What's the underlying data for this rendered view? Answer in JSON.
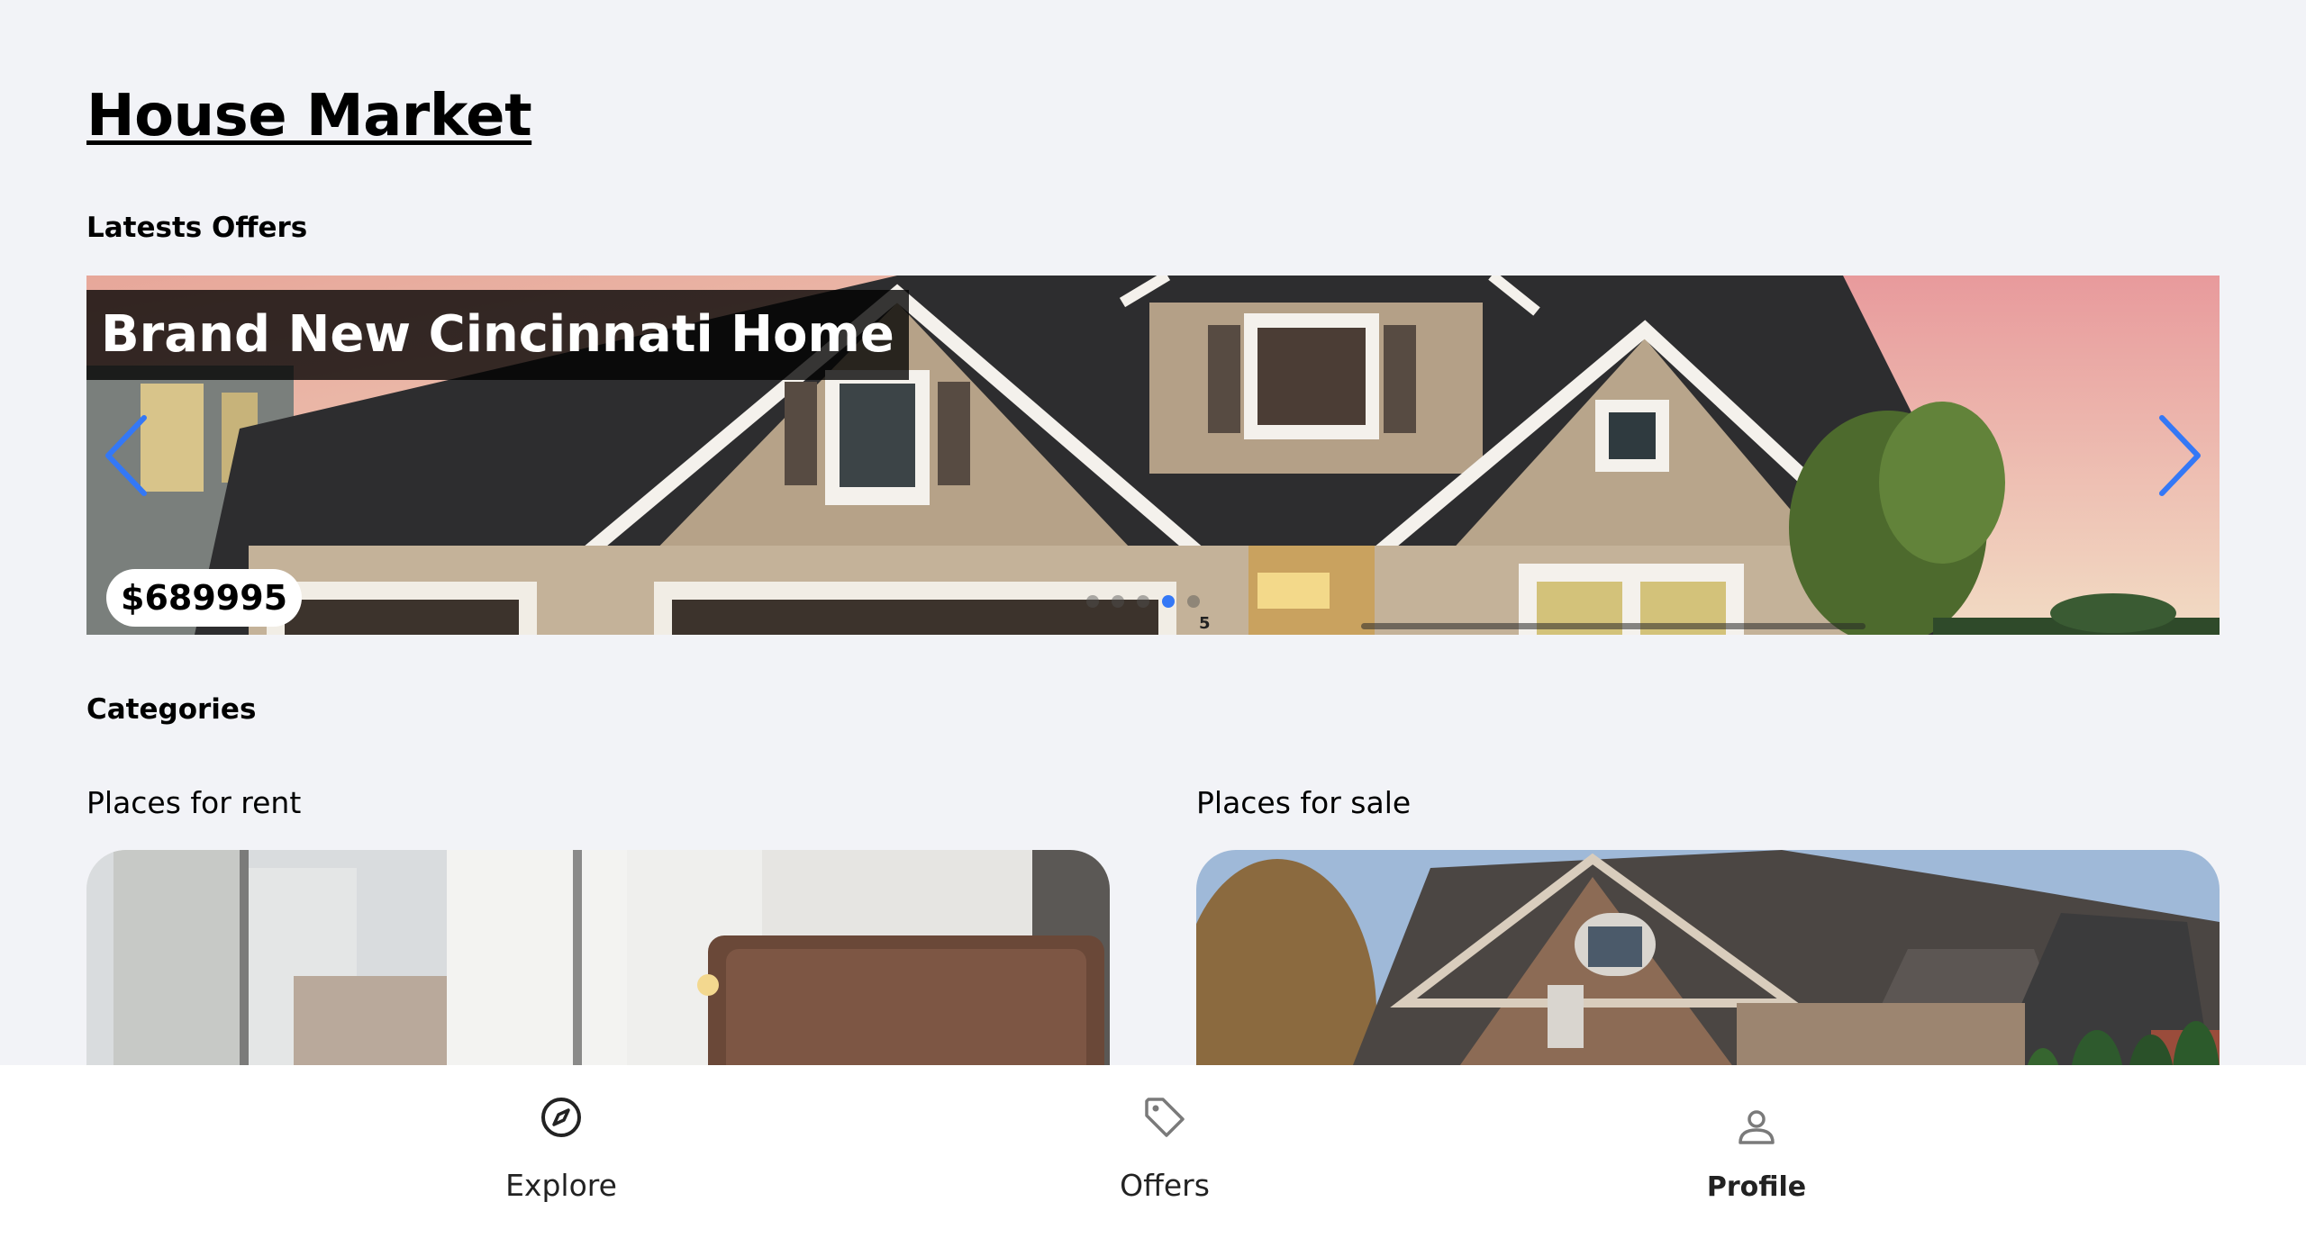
{
  "page": {
    "title": "House Market"
  },
  "sections": {
    "latest_offers": "Latests Offers",
    "categories": "Categories"
  },
  "slider": {
    "title": "Brand New Cincinnati Home",
    "price": "$689995",
    "index_label": "5",
    "accent_color": "#3478f6",
    "prev_icon": "chevron-left-icon",
    "next_icon": "chevron-right-icon"
  },
  "categories": [
    {
      "label": "Places for rent"
    },
    {
      "label": "Places for sale"
    }
  ],
  "bottom_nav": {
    "items": [
      {
        "label": "Explore",
        "icon": "compass-icon"
      },
      {
        "label": "Offers",
        "icon": "tag-icon"
      },
      {
        "label": "Profile",
        "icon": "person-icon"
      }
    ]
  }
}
